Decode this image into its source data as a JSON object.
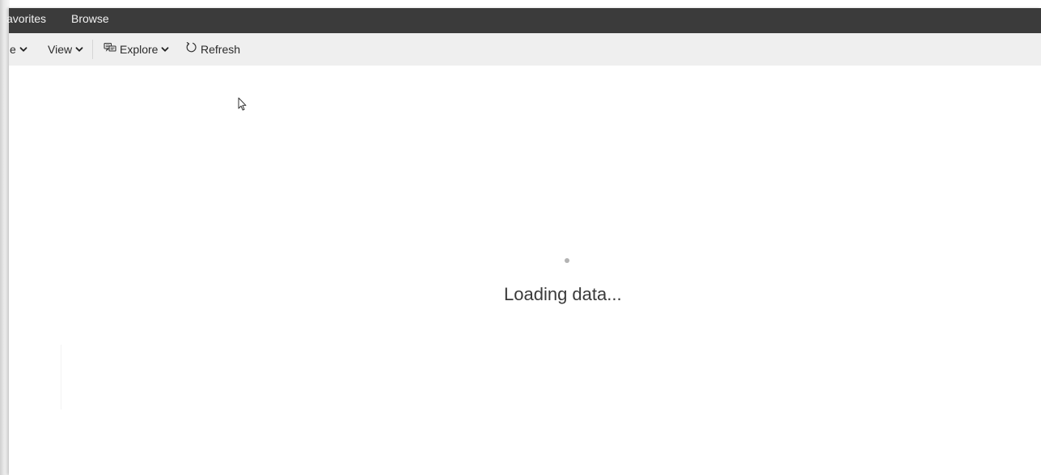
{
  "topbar": {
    "tabs": [
      {
        "label": "avorites"
      },
      {
        "label": "Browse"
      }
    ]
  },
  "toolbar": {
    "cut_label": "e",
    "view_label": "View",
    "explore_label": "Explore",
    "refresh_label": "Refresh"
  },
  "main": {
    "loading_text": "Loading data..."
  },
  "icons": {
    "explore": "explore-icon",
    "refresh": "refresh-icon",
    "chevron": "chevron-down-icon",
    "cursor": "mouse-cursor-icon"
  },
  "colors": {
    "topbar_bg": "#3b3b3b",
    "toolbar_bg": "#efefef",
    "spinner": "#b3b3b3"
  }
}
